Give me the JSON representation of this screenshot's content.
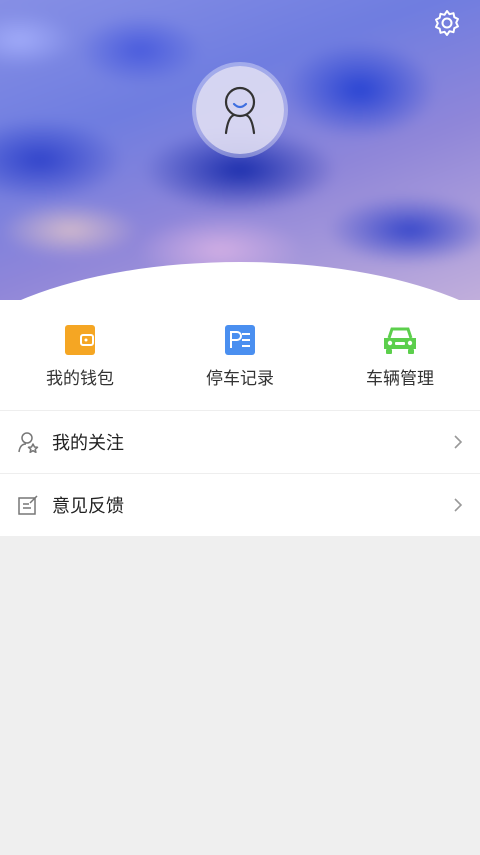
{
  "profile": {
    "settings_icon": "gear-icon",
    "avatar_icon": "user-avatar-icon"
  },
  "quick_actions": [
    {
      "label": "我的钱包",
      "icon": "wallet-icon",
      "color": "#f5a623"
    },
    {
      "label": "停车记录",
      "icon": "parking-record-icon",
      "color": "#4a8ff0"
    },
    {
      "label": "车辆管理",
      "icon": "car-icon",
      "color": "#5ccf4c"
    }
  ],
  "menu": [
    {
      "label": "我的关注",
      "icon": "follow-user-icon"
    },
    {
      "label": "意见反馈",
      "icon": "feedback-edit-icon"
    }
  ]
}
